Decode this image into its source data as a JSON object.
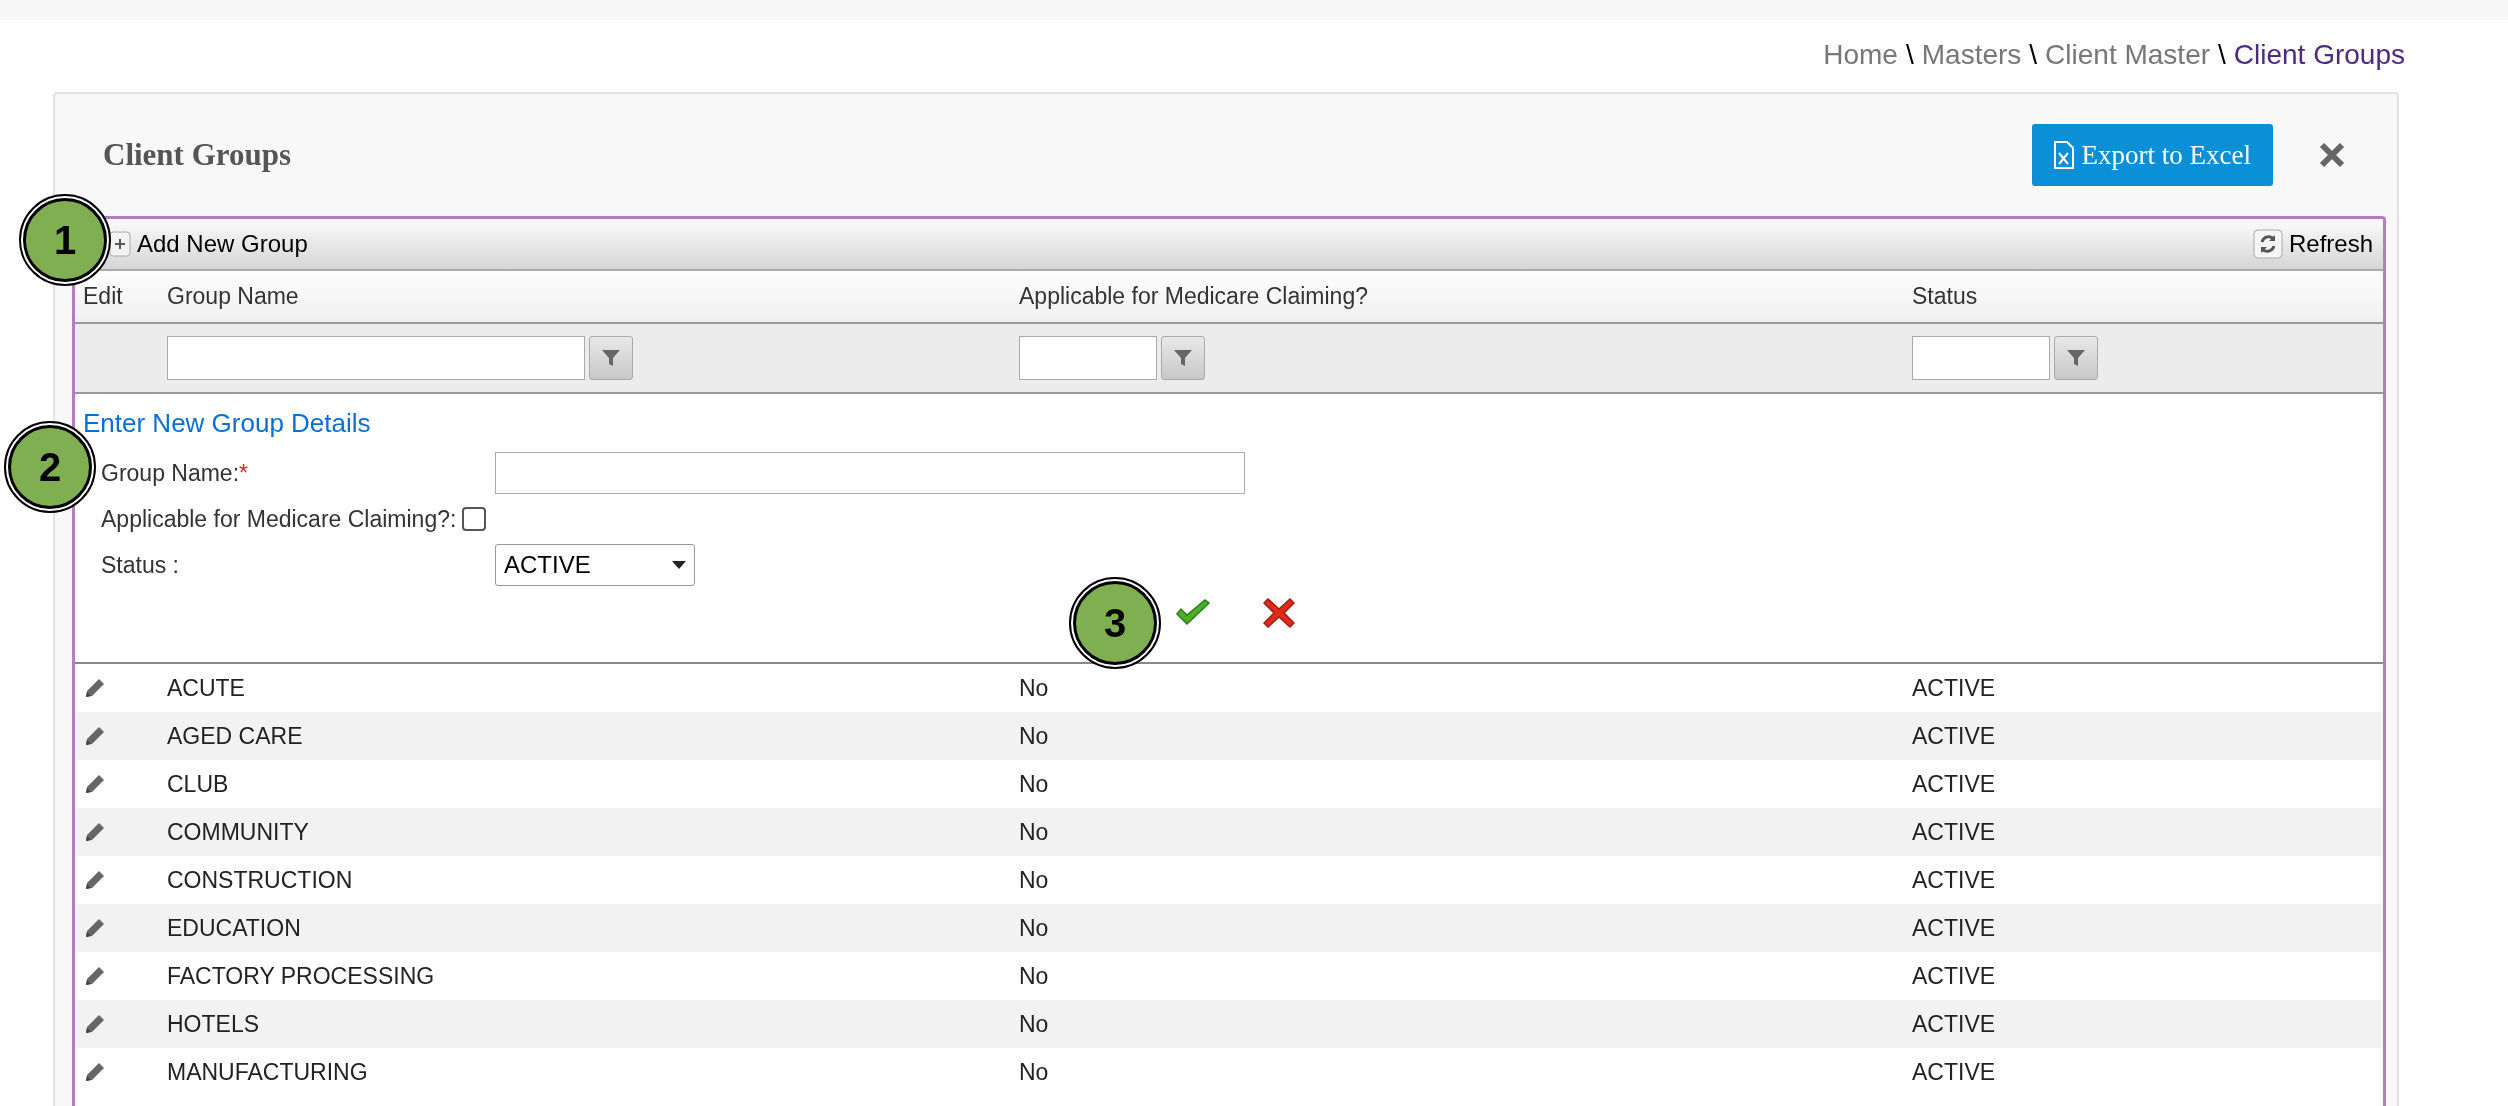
{
  "breadcrumb": {
    "separator": "\\",
    "items": [
      {
        "label": "Home",
        "current": false
      },
      {
        "label": "Masters",
        "current": false
      },
      {
        "label": "Client Master",
        "current": false
      },
      {
        "label": "Client Groups",
        "current": true
      }
    ]
  },
  "title": "Client Groups",
  "export_button": "Export to Excel",
  "toolbar": {
    "add_label": "Add New Group",
    "refresh_label": "Refresh"
  },
  "columns": [
    {
      "label": "Edit",
      "filterable": false
    },
    {
      "label": "Group Name",
      "filterable": true
    },
    {
      "label": "Applicable for Medicare Claiming?",
      "filterable": true
    },
    {
      "label": "Status",
      "filterable": true
    }
  ],
  "form": {
    "heading": "Enter New Group Details",
    "fields": [
      {
        "kind": "text",
        "label": "Group Name:",
        "required_mark": "*"
      },
      {
        "kind": "checkbox",
        "label": "Applicable for Medicare Claiming?:",
        "checked": false
      },
      {
        "kind": "select",
        "label": "Status :",
        "value": "ACTIVE"
      }
    ]
  },
  "rows": [
    {
      "name": "ACUTE",
      "medicare": "No",
      "status": "ACTIVE"
    },
    {
      "name": "AGED CARE",
      "medicare": "No",
      "status": "ACTIVE"
    },
    {
      "name": "CLUB",
      "medicare": "No",
      "status": "ACTIVE"
    },
    {
      "name": "COMMUNITY",
      "medicare": "No",
      "status": "ACTIVE"
    },
    {
      "name": "CONSTRUCTION",
      "medicare": "No",
      "status": "ACTIVE"
    },
    {
      "name": "EDUCATION",
      "medicare": "No",
      "status": "ACTIVE"
    },
    {
      "name": "FACTORY PROCESSING",
      "medicare": "No",
      "status": "ACTIVE"
    },
    {
      "name": "HOTELS",
      "medicare": "No",
      "status": "ACTIVE"
    },
    {
      "name": "MANUFACTURING",
      "medicare": "No",
      "status": "ACTIVE"
    }
  ],
  "callouts": [
    "1",
    "2",
    "3"
  ]
}
